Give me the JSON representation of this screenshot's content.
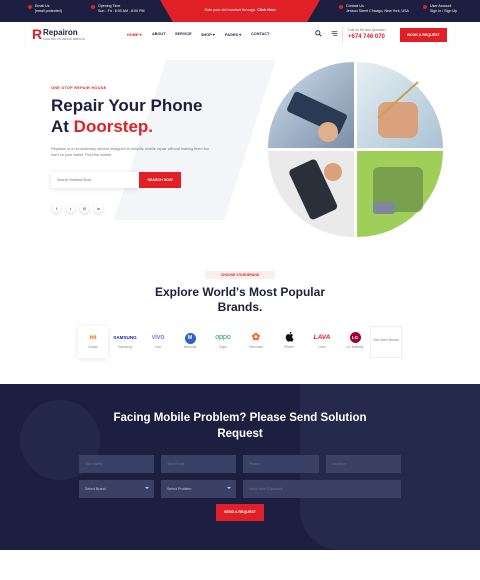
{
  "topbar": {
    "email_label": "Email Us",
    "email_value": "[email protected]",
    "hours_label": "Opening Time",
    "hours_value": "Sun - Fri : 8:00 AM - 8:00 PM",
    "promo_text": "Sale your old handset through.",
    "promo_link": "Click Here",
    "contact_label": "Contact Us",
    "contact_value": "Jenson Street Chicago, New York, USA",
    "account_label": "User Account",
    "account_value": "Sign In / Sign Up"
  },
  "header": {
    "logo_mark": "R",
    "logo_name": "Repairon",
    "logo_tagline": "SAVE BIG ON REPAIR SERVICE",
    "nav": [
      "HOME",
      "ABOUT",
      "SERVICE",
      "SHOP",
      "PAGES",
      "CONTACT"
    ],
    "call_label": "Call us for any question",
    "call_number": "+674 746 070",
    "book_button": "BOOK A REQUEST"
  },
  "hero": {
    "eyebrow": "ONE STOP REPAIR HOUSE",
    "title_line1": "Repair Your Phone",
    "title_line2_plain": "At ",
    "title_line2_red": "Doorstep.",
    "description": "Repairon is a revolutionary service designed to simplify mobile repair without making them too hard on your wallet. Find the mobile.",
    "search_placeholder": "Search Nearest Shop",
    "search_button": "SEARCH NOW",
    "social": [
      "f",
      "t",
      "◎",
      "in"
    ]
  },
  "brands": {
    "label": "CHOOSE YOUR BRAND",
    "title": "Explore World's Most Popular Brands.",
    "items": [
      {
        "logo": "mi",
        "name": "Xiaomi"
      },
      {
        "logo": "SAMSUNG",
        "name": "Samsung"
      },
      {
        "logo": "vivo",
        "name": "Vivo"
      },
      {
        "logo": "M",
        "name": "Motorola"
      },
      {
        "logo": "oppo",
        "name": "Oppo"
      },
      {
        "logo": "✿",
        "name": "Micromax"
      },
      {
        "logo": "",
        "name": "iPhone"
      },
      {
        "logo": "LAVA",
        "name": "Lava"
      },
      {
        "logo": "LG",
        "name": "LG Butterfly"
      }
    ],
    "more": "View More Brands"
  },
  "request": {
    "title": "Facing Mobile Problem? Please Send Solution Request",
    "fields": [
      "Your Name",
      "Your Email",
      "Phone",
      "Location"
    ],
    "selects": [
      "Select Brand",
      "Select Problem"
    ],
    "note_placeholder": "Write Note (Optional)",
    "button": "SEND A REQUEST"
  },
  "colors": {
    "accent": "#e01f26",
    "navy": "#1c1f3f"
  }
}
